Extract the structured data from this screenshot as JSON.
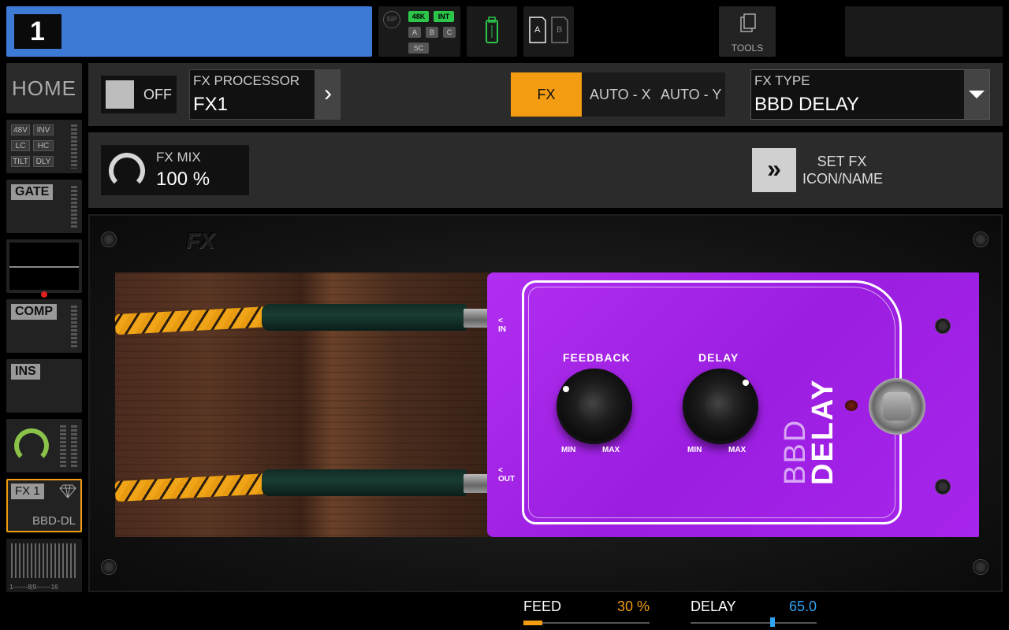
{
  "topbar": {
    "channel_number": "1",
    "status": {
      "sip": "SIP",
      "rate": "48K",
      "clock": "INT",
      "a": "A",
      "b": "B",
      "c": "C",
      "sc": "SC"
    },
    "ab_a": "A",
    "ab_b": "B",
    "tools_label": "TOOLS"
  },
  "sidebar": {
    "home": "HOME",
    "input_tags": [
      "48V",
      "INV",
      "LC",
      "HC",
      "TILT",
      "DLY"
    ],
    "gate": "GATE",
    "comp": "COMP",
    "ins": "INS",
    "fx_slot": "FX 1",
    "fx_name": "BBD-DL",
    "meter_scale": "1-------8|9-------16"
  },
  "header": {
    "off_label": "OFF",
    "processor_caption": "FX PROCESSOR",
    "processor_value": "FX1",
    "mode_fx": "FX",
    "mode_auto_x": "AUTO - X",
    "mode_auto_y": "AUTO - Y",
    "type_caption": "FX TYPE",
    "type_value": "BBD DELAY",
    "mix_caption": "FX MIX",
    "mix_value": "100 %",
    "set_fx_line1": "SET FX",
    "set_fx_line2": "ICON/NAME"
  },
  "pedal": {
    "stage_logo": "FX",
    "in_label": "IN",
    "out_label": "OUT",
    "feedback_label": "FEEDBACK",
    "delay_label": "DELAY",
    "min": "MIN",
    "max": "MAX",
    "brand_top": "BBD",
    "brand_bottom": "DELAY"
  },
  "params": [
    {
      "name": "FEED",
      "value": "30 %",
      "fraction": 0.3,
      "color": "#f39c12"
    },
    {
      "name": "DELAY",
      "value": "65.0",
      "fraction": 0.65,
      "color": "#2ea3f2"
    }
  ],
  "colors": {
    "accent": "#f39c12",
    "channel": "#3c7ad6",
    "pedal": "#a725ec",
    "status_green": "#2bc64a"
  }
}
